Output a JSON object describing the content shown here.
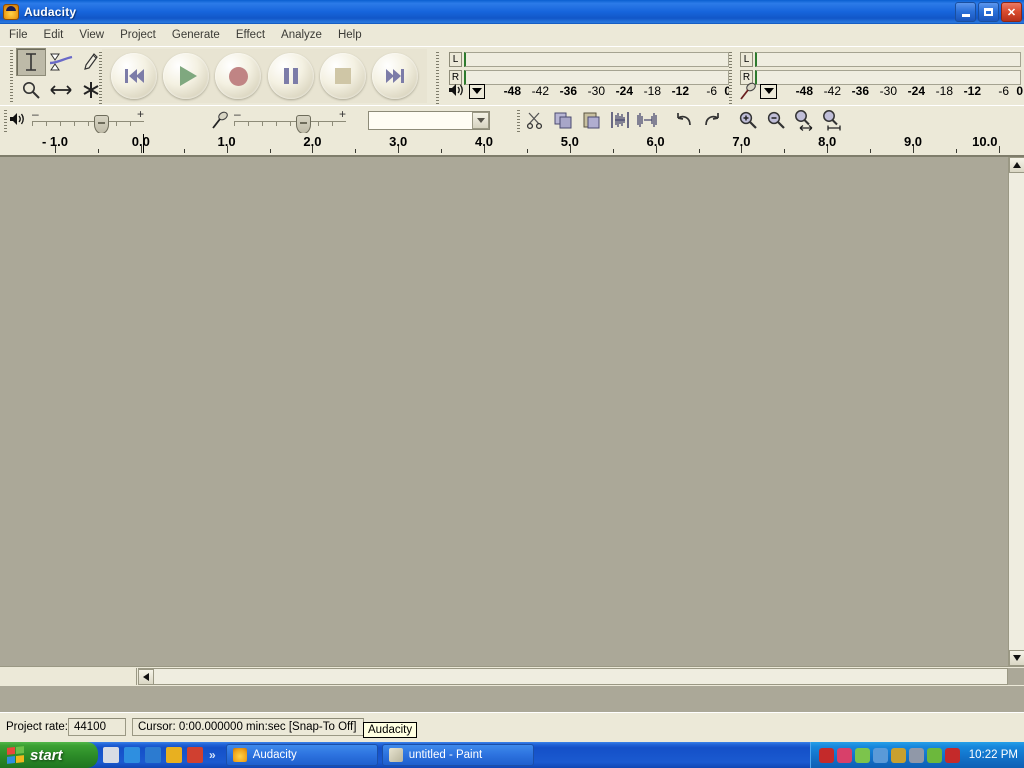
{
  "window": {
    "title": "Audacity",
    "icon": "audacity-logo-icon",
    "minimize_label": "Minimize",
    "restore_label": "Restore",
    "close_label": "Close"
  },
  "menubar": {
    "items": [
      {
        "label": "File"
      },
      {
        "label": "Edit"
      },
      {
        "label": "View"
      },
      {
        "label": "Project"
      },
      {
        "label": "Generate"
      },
      {
        "label": "Effect"
      },
      {
        "label": "Analyze"
      },
      {
        "label": "Help"
      }
    ]
  },
  "tools_toolbar": {
    "tools": [
      {
        "name": "selection-tool",
        "active": true
      },
      {
        "name": "envelope-tool",
        "active": false
      },
      {
        "name": "draw-tool",
        "active": false
      },
      {
        "name": "zoom-tool",
        "active": false
      },
      {
        "name": "timeshift-tool",
        "active": false
      },
      {
        "name": "multi-tool",
        "active": false
      }
    ]
  },
  "transport": {
    "buttons": [
      {
        "name": "skip-to-start-button"
      },
      {
        "name": "play-button"
      },
      {
        "name": "record-button"
      },
      {
        "name": "pause-button"
      },
      {
        "name": "stop-button"
      },
      {
        "name": "skip-to-end-button"
      }
    ]
  },
  "meters": {
    "db_scale": [
      "-48",
      "-42",
      "-36",
      "-30",
      "-24",
      "-18",
      "-12",
      "-6",
      "0"
    ],
    "channels": [
      "L",
      "R"
    ],
    "output": {
      "icon": "speaker-icon",
      "level_l": 0,
      "level_r": 0
    },
    "input": {
      "icon": "microphone-icon",
      "level_l": 0,
      "level_r": 0
    }
  },
  "mixer": {
    "output_volume": {
      "icon": "speaker-icon",
      "minus": "–",
      "plus": "+",
      "value": 62
    },
    "input_volume": {
      "icon": "microphone-icon",
      "minus": "–",
      "plus": "+",
      "value": 62
    },
    "input_source": {
      "value": "",
      "placeholder": ""
    }
  },
  "edit_toolbar": {
    "buttons": [
      {
        "name": "cut-button"
      },
      {
        "name": "copy-button"
      },
      {
        "name": "paste-button"
      },
      {
        "name": "trim-outside-selection-button"
      },
      {
        "name": "silence-selection-button"
      },
      {
        "name": "undo-button"
      },
      {
        "name": "redo-button"
      },
      {
        "name": "zoom-in-button"
      },
      {
        "name": "zoom-out-button"
      },
      {
        "name": "fit-selection-button"
      },
      {
        "name": "fit-project-button"
      }
    ]
  },
  "ruler": {
    "unit": "seconds",
    "labels": [
      "- 1.0",
      "0.0",
      "1.0",
      "2.0",
      "3.0",
      "4.0",
      "5.0",
      "6.0",
      "7.0",
      "8.0",
      "9.0",
      "10.0"
    ],
    "cursor_label": "0.0"
  },
  "track_panel": {
    "tracks": [],
    "background_color": "#ABA898",
    "empty": true
  },
  "statusbar": {
    "project_rate_label": "Project rate:",
    "project_rate_value": "44100",
    "cursor_text": "Cursor: 0:00.000000 min:sec   [Snap-To Off]"
  },
  "tooltip": {
    "text": "Audacity"
  },
  "taskbar": {
    "start_label": "start",
    "quick_launch": [
      {
        "name": "show-desktop-icon",
        "color": "#D8DCE4"
      },
      {
        "name": "internet-explorer-icon",
        "color": "#2E8FE0"
      },
      {
        "name": "media-player-icon",
        "color": "#2C7BD0"
      },
      {
        "name": "messenger-icon",
        "color": "#E8B020"
      },
      {
        "name": "shortcut-icon",
        "color": "#D04030"
      }
    ],
    "overflow_label": "»",
    "tasks": [
      {
        "name": "taskbutton-audacity",
        "label": "Audacity",
        "icon_color": "#F2A61C",
        "active": true
      },
      {
        "name": "taskbutton-paint",
        "label": "untitled - Paint",
        "icon_color": "#E8E4D0",
        "active": false
      }
    ],
    "tray_icons": [
      {
        "name": "tray-antivirus-icon",
        "color": "#C42A2A"
      },
      {
        "name": "tray-network-alert-icon",
        "color": "#D8406A"
      },
      {
        "name": "tray-update-icon",
        "color": "#7CC44C"
      },
      {
        "name": "tray-connection-icon",
        "color": "#5A9AD8"
      },
      {
        "name": "tray-sound-icon",
        "color": "#C8A030"
      },
      {
        "name": "tray-volume-icon",
        "color": "#9098A8"
      },
      {
        "name": "tray-sync-icon",
        "color": "#6CB83C"
      },
      {
        "name": "tray-mcafee-icon",
        "color": "#C42A2A"
      }
    ],
    "clock": "10:22 PM"
  }
}
